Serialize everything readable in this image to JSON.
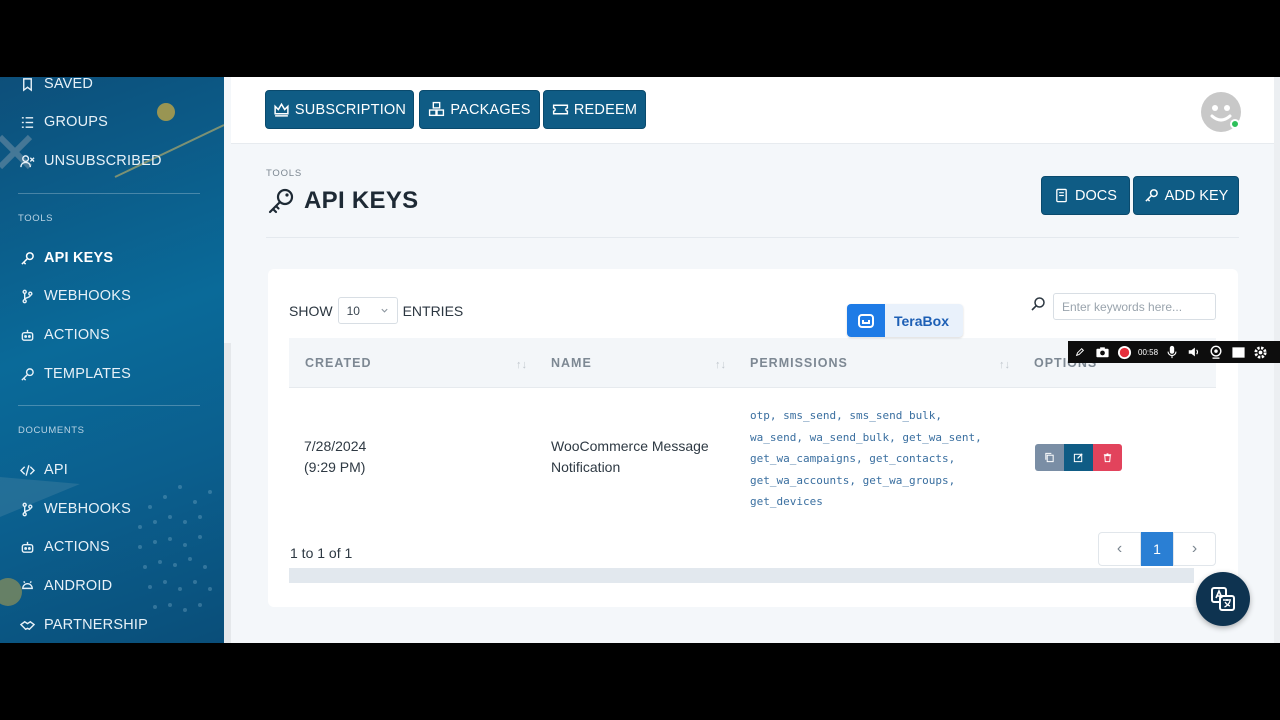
{
  "sidebar": {
    "items_top": [
      {
        "label": "SAVED",
        "icon": "bookmark-icon"
      },
      {
        "label": "GROUPS",
        "icon": "list-icon"
      },
      {
        "label": "UNSUBSCRIBED",
        "icon": "user-x-icon"
      }
    ],
    "section_tools": "TOOLS",
    "items_tools": [
      {
        "label": "API KEYS",
        "icon": "key-icon",
        "active": true
      },
      {
        "label": "WEBHOOKS",
        "icon": "branch-icon"
      },
      {
        "label": "ACTIONS",
        "icon": "robot-icon"
      },
      {
        "label": "TEMPLATES",
        "icon": "key-icon"
      }
    ],
    "section_documents": "DOCUMENTS",
    "items_documents": [
      {
        "label": "API",
        "icon": "code-icon"
      },
      {
        "label": "WEBHOOKS",
        "icon": "branch-icon"
      },
      {
        "label": "ACTIONS",
        "icon": "robot-icon"
      },
      {
        "label": "ANDROID",
        "icon": "android-icon"
      },
      {
        "label": "PARTNERSHIP",
        "icon": "handshake-icon"
      }
    ]
  },
  "topbar": {
    "subscription": "SUBSCRIPTION",
    "packages": "PACKAGES",
    "redeem": "REDEEM"
  },
  "page": {
    "breadcrumb": "TOOLS",
    "title": "API KEYS",
    "docs": "DOCS",
    "add_key": "ADD KEY"
  },
  "table": {
    "show_label": "SHOW",
    "entries_value": "10",
    "entries_label": "ENTRIES",
    "search_placeholder": "Enter keywords here...",
    "columns": [
      "CREATED",
      "NAME",
      "PERMISSIONS",
      "OPTIONS"
    ],
    "rows": [
      {
        "created_date": "7/28/2024",
        "created_time": "(9:29 PM)",
        "name_line1": "WooCommerce Message",
        "name_line2": "Notification",
        "permissions": [
          "otp, sms_send, sms_send_bulk,",
          "wa_send, wa_send_bulk, get_wa_sent,",
          "get_wa_campaigns, get_contacts,",
          "get_wa_accounts, get_wa_groups,",
          "get_devices"
        ]
      }
    ],
    "count_text": "1 to 1 of 1",
    "page_current": "1",
    "prev": "‹",
    "next": "›"
  },
  "overlay": {
    "terabox_label": "TeraBox",
    "recorder_time": "00:58"
  },
  "colors": {
    "primary": "#0f5c85",
    "danger": "#e2435c",
    "secondary": "#7a8ea5",
    "active_page": "#2a7fd4"
  }
}
